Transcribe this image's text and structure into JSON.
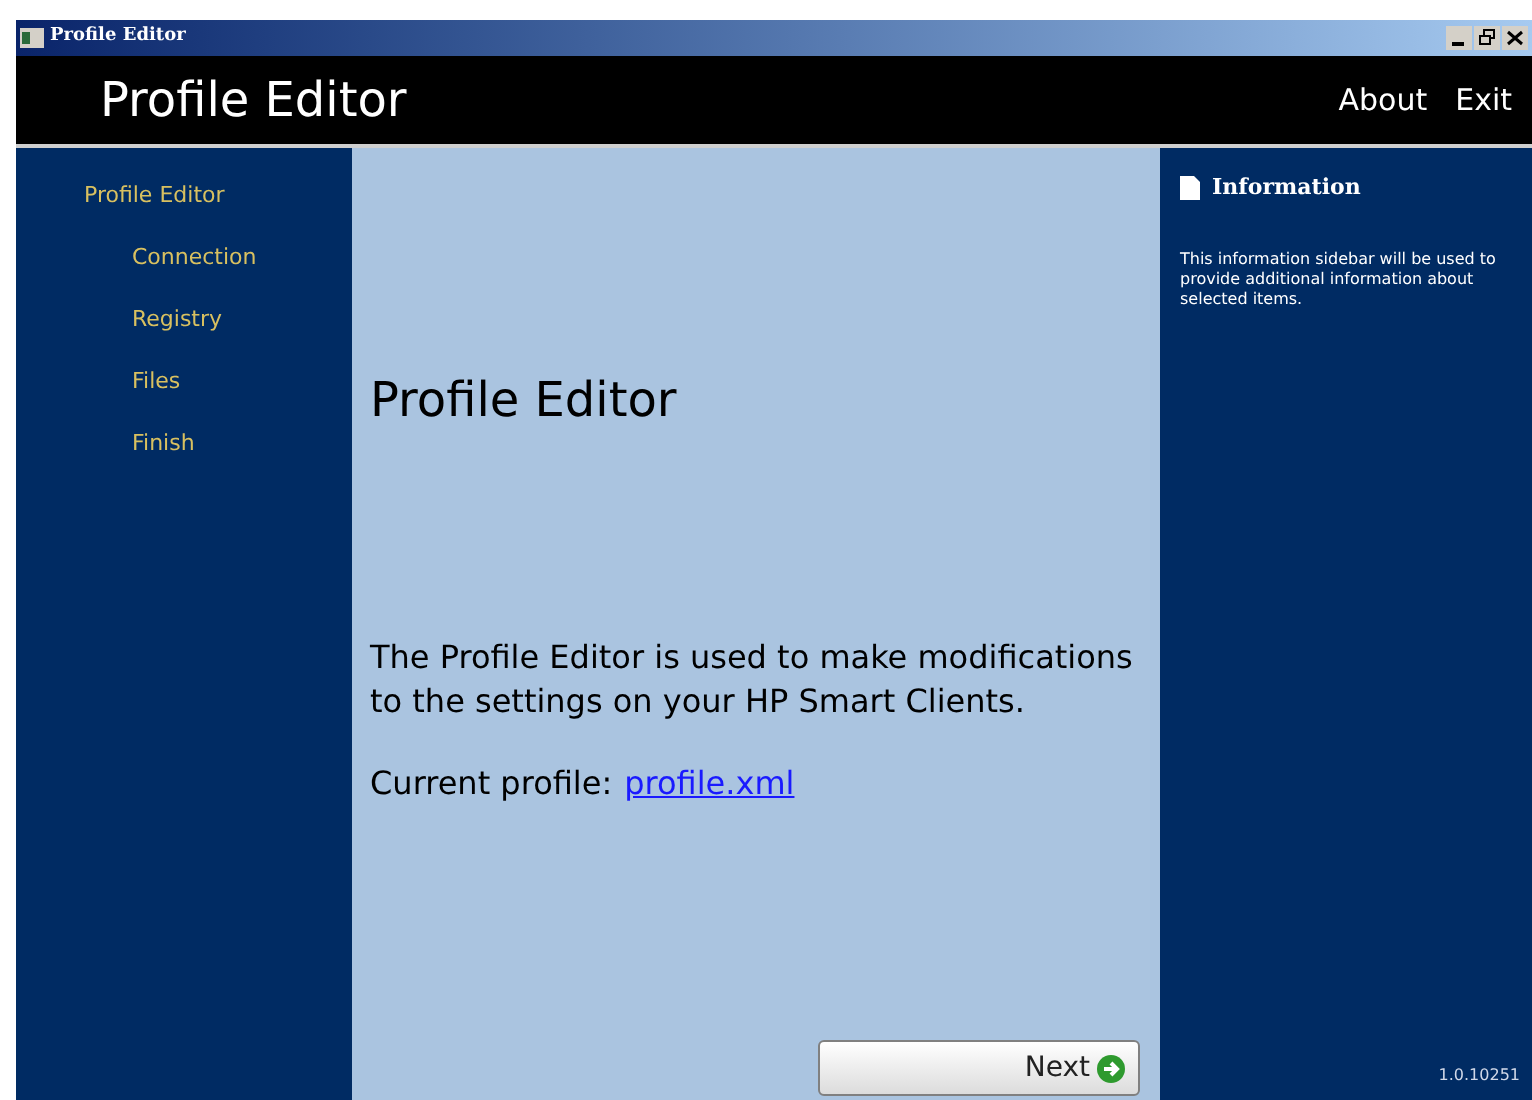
{
  "window": {
    "title": "Profile Editor"
  },
  "header": {
    "title": "Profile Editor",
    "links": [
      "About",
      "Exit"
    ]
  },
  "sidebar": {
    "items": [
      {
        "label": "Profile Editor",
        "children": [
          {
            "label": "Connection"
          },
          {
            "label": "Registry"
          },
          {
            "label": "Files"
          },
          {
            "label": "Finish"
          }
        ]
      }
    ]
  },
  "main": {
    "heading": "Profile Editor",
    "description": "The Profile Editor is used to make modifications to the settings on your HP Smart Clients.",
    "profile_label": "Current profile:",
    "profile_link": "profile.xml",
    "next_button": "Next"
  },
  "info_panel": {
    "title": "Information",
    "text": "This information sidebar will be used to provide additional information about selected items.",
    "version": "1.0.10251"
  }
}
